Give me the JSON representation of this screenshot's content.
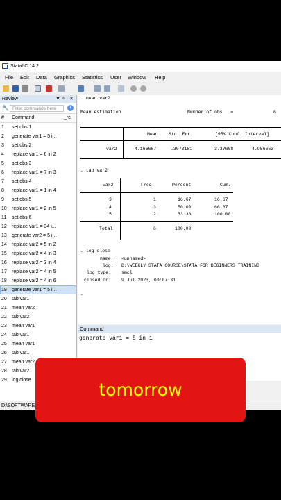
{
  "window": {
    "title": "Stata/IC 14.2"
  },
  "menu": [
    "File",
    "Edit",
    "Data",
    "Graphics",
    "Statistics",
    "User",
    "Window",
    "Help"
  ],
  "review": {
    "title": "Review",
    "filter_placeholder": "Filter commands here",
    "col_number": "#",
    "col_command": "Command",
    "col_rc": "_rc",
    "items": [
      {
        "n": "1",
        "cmd": "set obs 1"
      },
      {
        "n": "2",
        "cmd": "generate var1 = 5 i..."
      },
      {
        "n": "3",
        "cmd": "set obs 2"
      },
      {
        "n": "4",
        "cmd": "replace var1 = 6 in 2"
      },
      {
        "n": "5",
        "cmd": "set obs 3"
      },
      {
        "n": "6",
        "cmd": "replace var1 = 7 in 3"
      },
      {
        "n": "7",
        "cmd": "set obs 4"
      },
      {
        "n": "8",
        "cmd": "replace var1 = 1 in 4"
      },
      {
        "n": "9",
        "cmd": "set obs 5"
      },
      {
        "n": "10",
        "cmd": "replace var1 = 2 in 5"
      },
      {
        "n": "11",
        "cmd": "set obs 6"
      },
      {
        "n": "12",
        "cmd": "replace var1 = 34 i..."
      },
      {
        "n": "13",
        "cmd": "generate var2 = 5 i..."
      },
      {
        "n": "14",
        "cmd": "replace var2 = 5 in 2"
      },
      {
        "n": "15",
        "cmd": "replace var2 = 4 in 3"
      },
      {
        "n": "16",
        "cmd": "replace var2 = 3 in 4"
      },
      {
        "n": "17",
        "cmd": "replace var2 = 4 in 5"
      },
      {
        "n": "18",
        "cmd": "replace var2 = 4 in 6"
      },
      {
        "n": "19",
        "cmd": "generate var1 = 5 i..."
      },
      {
        "n": "20",
        "cmd": "tab var1"
      },
      {
        "n": "21",
        "cmd": "mean var2"
      },
      {
        "n": "22",
        "cmd": "tab var2"
      },
      {
        "n": "23",
        "cmd": "mean var1"
      },
      {
        "n": "24",
        "cmd": "tab var1"
      },
      {
        "n": "25",
        "cmd": "mean var1"
      },
      {
        "n": "26",
        "cmd": "tab var1"
      },
      {
        "n": "27",
        "cmd": "mean var2"
      },
      {
        "n": "28",
        "cmd": "tab var2"
      },
      {
        "n": "29",
        "cmd": "log close"
      }
    ],
    "selected_index": 18
  },
  "results": {
    "cmd_mean": ". mean var2",
    "mean_title": "Mean estimation",
    "nobs_label": "Number of obs   =",
    "nobs_value": "6",
    "h_mean": "Mean",
    "h_se": "Std. Err.",
    "h_ci": "[95% Conf. Interval]",
    "row_var": "var2",
    "row_mean": "4.166667",
    "row_se": ".3073181",
    "row_lo": "3.37668",
    "row_hi": "4.956653",
    "cmd_tab": ". tab var2",
    "t_h_var": "var2",
    "t_h_freq": "Freq.",
    "t_h_pct": "Percent",
    "t_h_cum": "Cum.",
    "tab_rows": [
      {
        "v": "3",
        "f": "1",
        "p": "16.67",
        "c": "16.67"
      },
      {
        "v": "4",
        "f": "3",
        "p": "50.00",
        "c": "66.67"
      },
      {
        "v": "5",
        "f": "2",
        "p": "33.33",
        "c": "100.00"
      }
    ],
    "total_label": "Total",
    "total_freq": "6",
    "total_pct": "100.00",
    "cmd_log": ". log close",
    "log_name_label": "name:",
    "log_name_value": "<unnamed>",
    "log_log_label": "log:",
    "log_log_value": "D:\\WEEKLY STATA COURSE\\STATA FOR BEGINNERS TRAINING",
    "log_type_label": "log type:",
    "log_type_value": "smcl",
    "closed_label": "closed on:",
    "closed_value": "9 Jul 2023, 00:07:31",
    "prompt": "."
  },
  "command": {
    "title": "Command",
    "value": "generate var1 = 5 in 1"
  },
  "status": {
    "path": "D:\\SOFTWARE"
  },
  "caption": {
    "text": "tomorrow"
  }
}
